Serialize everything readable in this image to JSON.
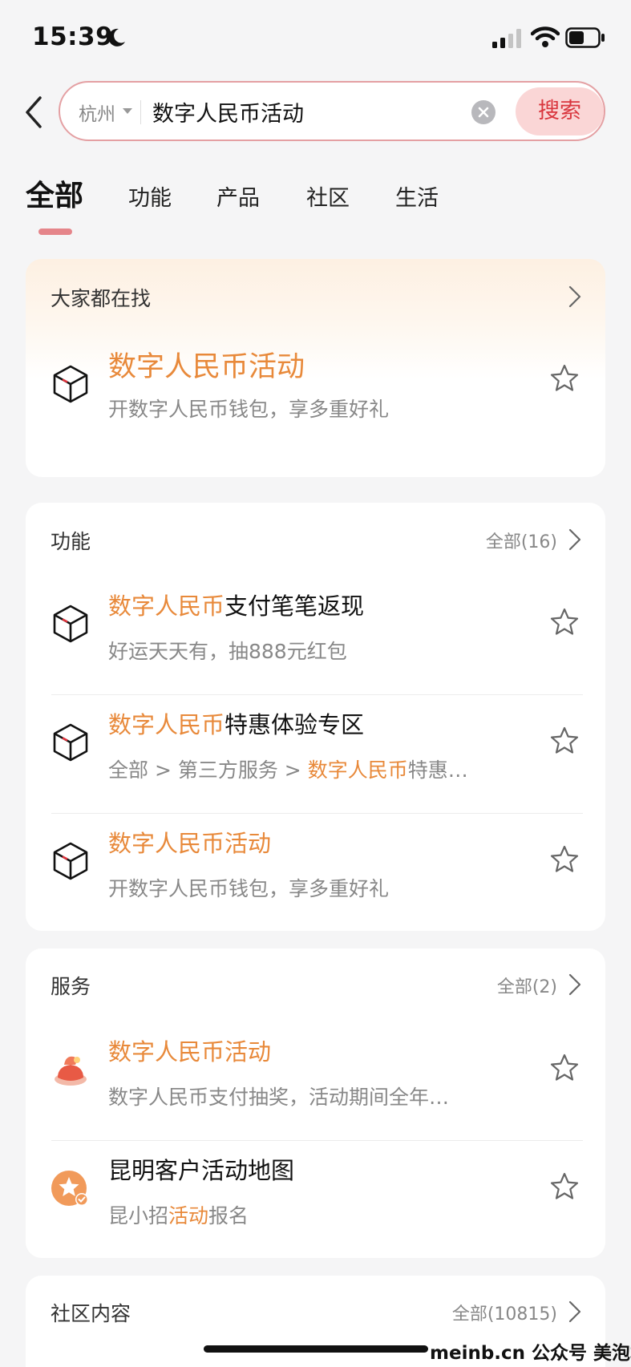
{
  "status_bar": {
    "time": "15:39"
  },
  "search": {
    "city": "杭州",
    "query": "数字人民币活动",
    "button_label": "搜索"
  },
  "tabs": [
    {
      "label": "全部",
      "active": true
    },
    {
      "label": "功能",
      "active": false
    },
    {
      "label": "产品",
      "active": false
    },
    {
      "label": "社区",
      "active": false
    },
    {
      "label": "生活",
      "active": false
    }
  ],
  "hot": {
    "title": "大家都在找",
    "item": {
      "title": "数字人民币活动",
      "subtitle": "开数字人民币钱包，享多重好礼"
    }
  },
  "functions": {
    "title": "功能",
    "more_label": "全部(16)",
    "items": [
      {
        "title_hl": "数字人民币",
        "title_rest": "支付笔笔返现",
        "subtitle": "好运天天有，抽888元红包"
      },
      {
        "title_hl": "数字人民币",
        "title_rest": "特惠体验专区",
        "sub_pre": "全部 > 第三方服务 > ",
        "sub_hl": "数字人民币",
        "sub_post": "特惠…"
      },
      {
        "title_hl": "数字人民币活动",
        "title_rest": "",
        "subtitle": "开数字人民币钱包，享多重好礼"
      }
    ]
  },
  "services": {
    "title": "服务",
    "more_label": "全部(2)",
    "items": [
      {
        "title_hl": "数字人民币活动",
        "title_rest": "",
        "subtitle": "数字人民币支付抽奖，活动期间全年…"
      },
      {
        "title_hl": "",
        "title_rest": "昆明客户活动地图",
        "sub_pre": "昆小招",
        "sub_hl": "活动",
        "sub_post": "报名"
      }
    ]
  },
  "community": {
    "title": "社区内容",
    "more_label": "全部(10815)"
  },
  "watermark": "meinb.cn 公众号 美泡君",
  "colors": {
    "accent": "#e8893a",
    "brand_red": "#d9363e",
    "search_btn_bg": "#fad6d6",
    "tab_indicator": "#e5858a"
  }
}
